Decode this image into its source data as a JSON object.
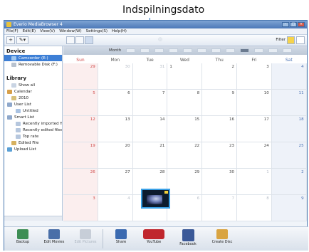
{
  "callout": {
    "label": "Indspilningsdato"
  },
  "window": {
    "title": "Everio MediaBrowser 4",
    "controls": [
      "–",
      "□",
      "×"
    ]
  },
  "menu": [
    "File(F)",
    "Edit(E)",
    "View(V)",
    "Window(W)",
    "Settings(S)",
    "Help(H)"
  ],
  "toolbar": {
    "add_label": "+",
    "tools_label": "✎▾",
    "filter_label": "Filter"
  },
  "sidebar": {
    "device_heading": "Device",
    "devices": [
      {
        "label": "Camcorder (E:)",
        "selected": true
      },
      {
        "label": "Removable Disk (F:)",
        "selected": false
      }
    ],
    "library_heading": "Library",
    "library": [
      {
        "label": "Show all",
        "indent": 1
      },
      {
        "label": "Calendar",
        "indent": 0
      },
      {
        "label": "2010",
        "indent": 1
      },
      {
        "label": "User List",
        "indent": 0
      },
      {
        "label": "Untitled",
        "indent": 2
      },
      {
        "label": "Smart List",
        "indent": 0
      },
      {
        "label": "Recently imported files",
        "indent": 2
      },
      {
        "label": "Recently edited files",
        "indent": 2
      },
      {
        "label": "Top rate",
        "indent": 2
      },
      {
        "label": "Edited File",
        "indent": 1
      },
      {
        "label": "Upload List",
        "indent": 0
      }
    ]
  },
  "calendar": {
    "month_label": "Month",
    "current_month_index": 8,
    "day_names": [
      "Sun",
      "Mon",
      "Tue",
      "Wed",
      "Thu",
      "Fri",
      "Sat"
    ],
    "weeks": [
      [
        {
          "d": "29",
          "out": true
        },
        {
          "d": "30",
          "out": true
        },
        {
          "d": "31",
          "out": true
        },
        {
          "d": "1"
        },
        {
          "d": "2"
        },
        {
          "d": "3"
        },
        {
          "d": "4"
        }
      ],
      [
        {
          "d": "5"
        },
        {
          "d": "6"
        },
        {
          "d": "7"
        },
        {
          "d": "8"
        },
        {
          "d": "9"
        },
        {
          "d": "10"
        },
        {
          "d": "11"
        }
      ],
      [
        {
          "d": "12"
        },
        {
          "d": "13"
        },
        {
          "d": "14"
        },
        {
          "d": "15"
        },
        {
          "d": "16"
        },
        {
          "d": "17"
        },
        {
          "d": "18"
        }
      ],
      [
        {
          "d": "19"
        },
        {
          "d": "20"
        },
        {
          "d": "21"
        },
        {
          "d": "22"
        },
        {
          "d": "23"
        },
        {
          "d": "24"
        },
        {
          "d": "25"
        }
      ],
      [
        {
          "d": "26"
        },
        {
          "d": "27"
        },
        {
          "d": "28"
        },
        {
          "d": "29"
        },
        {
          "d": "30"
        },
        {
          "d": "1",
          "out": true
        },
        {
          "d": "2",
          "out": true
        }
      ],
      [
        {
          "d": "3",
          "out": true
        },
        {
          "d": "4",
          "out": true
        },
        {
          "d": "5",
          "out": true
        },
        {
          "d": "6",
          "out": true
        },
        {
          "d": "7",
          "out": true
        },
        {
          "d": "8",
          "out": true
        },
        {
          "d": "9",
          "out": true
        }
      ]
    ],
    "wed_first_week_label": "9"
  },
  "actions": [
    {
      "label": "Backup",
      "icon": "backup-icon",
      "enabled": true
    },
    {
      "label": "Edit Movies",
      "icon": "edit-movies-icon",
      "enabled": true
    },
    {
      "label": "Edit Pictures",
      "icon": "edit-pictures-icon",
      "enabled": false
    },
    {
      "label": "Share",
      "icon": "share-icon",
      "enabled": true
    },
    {
      "label": "YouTube",
      "icon": "youtube-icon",
      "enabled": true
    },
    {
      "label": "Facebook",
      "icon": "facebook-icon",
      "enabled": true
    },
    {
      "label": "Create Disc",
      "icon": "create-disc-icon",
      "enabled": true
    }
  ],
  "colors": {
    "accent": "#3d7fd6",
    "callout_line": "#1a6fc0",
    "sunday": "#d04a4a",
    "saturday": "#4b73b5"
  }
}
